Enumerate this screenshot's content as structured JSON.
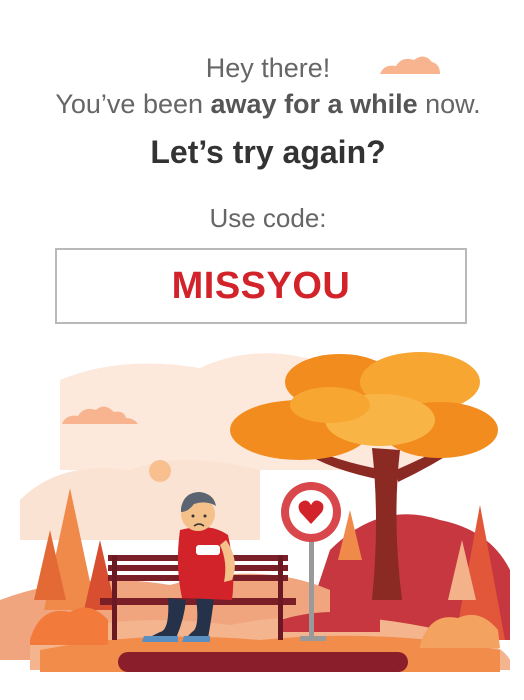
{
  "greeting": {
    "line1": "Hey there!",
    "line2_prefix": "You’ve been ",
    "line2_bold": "away for a while",
    "line2_suffix": " now."
  },
  "headline": "Let’s try again?",
  "code_label": "Use code:",
  "code_value": "MISSYOU",
  "colors": {
    "code_red": "#d2232a",
    "tree_orange": "#f28c1e",
    "cloud_peach": "#f7b48f"
  },
  "illustration": {
    "icons": [
      "cloud-icon",
      "tree-icon",
      "bench-icon",
      "heart-sign-icon",
      "man-figure-icon",
      "sun-icon"
    ]
  }
}
